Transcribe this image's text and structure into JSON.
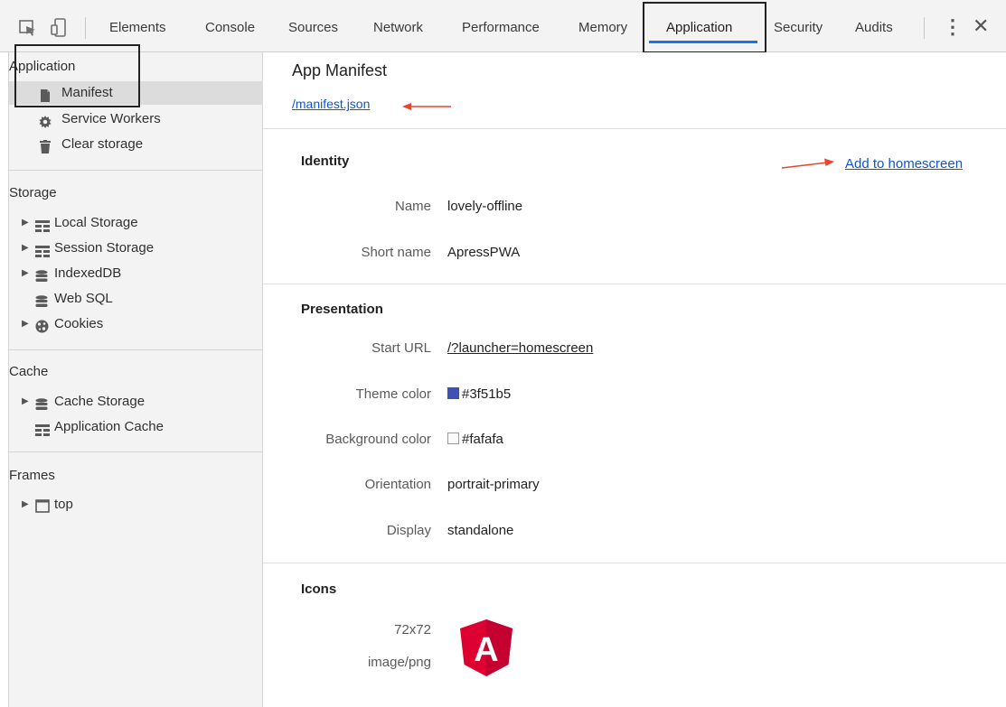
{
  "toolbar": {
    "inspect_icon": "cursor-select-icon",
    "device_icon": "device-toggle-icon",
    "tabs": [
      "Elements",
      "Console",
      "Sources",
      "Network",
      "Performance",
      "Memory",
      "Application",
      "Security",
      "Audits"
    ],
    "active_tab": "Application",
    "more_icon": "kebab-menu-icon",
    "close_icon": "close-icon",
    "accent_color": "#1a73e8"
  },
  "sidebar": {
    "application": {
      "title": "Application",
      "items": [
        {
          "label": "Manifest",
          "icon": "document-icon",
          "selected": true
        },
        {
          "label": "Service Workers",
          "icon": "gear-icon"
        },
        {
          "label": "Clear storage",
          "icon": "trash-icon"
        }
      ]
    },
    "storage": {
      "title": "Storage",
      "items": [
        {
          "label": "Local Storage",
          "icon": "grid-icon",
          "expandable": true
        },
        {
          "label": "Session Storage",
          "icon": "grid-icon",
          "expandable": true
        },
        {
          "label": "IndexedDB",
          "icon": "database-icon",
          "expandable": true
        },
        {
          "label": "Web SQL",
          "icon": "database-icon",
          "expandable": false
        },
        {
          "label": "Cookies",
          "icon": "cookie-icon",
          "expandable": true
        }
      ]
    },
    "cache": {
      "title": "Cache",
      "items": [
        {
          "label": "Cache Storage",
          "icon": "database-icon",
          "expandable": true
        },
        {
          "label": "Application Cache",
          "icon": "grid-icon",
          "expandable": false
        }
      ]
    },
    "frames": {
      "title": "Frames",
      "items": [
        {
          "label": "top",
          "icon": "frame-icon",
          "expandable": true
        }
      ]
    }
  },
  "main": {
    "title": "App Manifest",
    "manifest_link": "/manifest.json",
    "identity": {
      "title": "Identity",
      "add_to_homescreen": "Add to homescreen",
      "rows": [
        {
          "label": "Name",
          "value": "lovely-offline"
        },
        {
          "label": "Short name",
          "value": "ApressPWA"
        }
      ]
    },
    "presentation": {
      "title": "Presentation",
      "start_url_label": "Start URL",
      "start_url": "/?launcher=homescreen",
      "theme_color_label": "Theme color",
      "theme_color": "#3f51b5",
      "background_color_label": "Background color",
      "background_color": "#fafafa",
      "orientation_label": "Orientation",
      "orientation": "portrait-primary",
      "display_label": "Display",
      "display": "standalone"
    },
    "icons": {
      "title": "Icons",
      "size": "72x72",
      "type": "image/png",
      "icon": "angular-logo-icon",
      "logo_color": "#dd0031",
      "logo_letter": "A"
    },
    "annotation_color": "#e8442e"
  }
}
